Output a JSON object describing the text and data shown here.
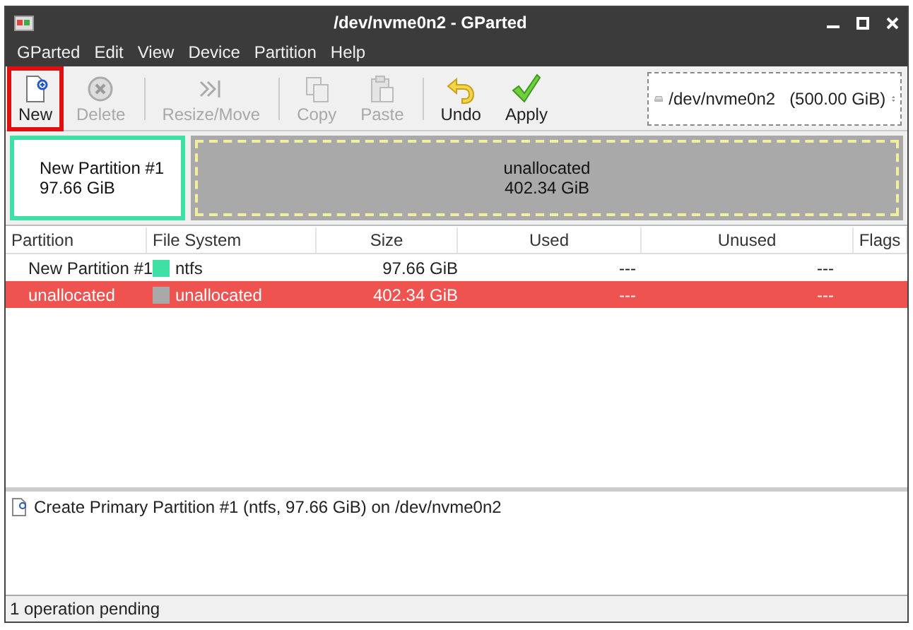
{
  "window": {
    "title": "/dev/nvme0n2 - GParted"
  },
  "menu": [
    "GParted",
    "Edit",
    "View",
    "Device",
    "Partition",
    "Help"
  ],
  "toolbar": [
    {
      "label": "New",
      "kind": "new",
      "disabled": false,
      "highlighted": true
    },
    {
      "label": "Delete",
      "kind": "delete",
      "disabled": true,
      "highlighted": false
    },
    {
      "label": "Resize/Move",
      "kind": "resize",
      "disabled": true,
      "highlighted": false
    },
    {
      "label": "Copy",
      "kind": "copy",
      "disabled": true,
      "highlighted": false
    },
    {
      "label": "Paste",
      "kind": "paste",
      "disabled": true,
      "highlighted": false
    },
    {
      "label": "Undo",
      "kind": "undo",
      "disabled": false,
      "highlighted": false
    },
    {
      "label": "Apply",
      "kind": "apply",
      "disabled": false,
      "highlighted": false
    }
  ],
  "device": {
    "name": "/dev/nvme0n2",
    "size": "(500.00 GiB)"
  },
  "disk_map": [
    {
      "name": "New Partition #1",
      "size": "97.66 GiB",
      "color": "#3ee0a6",
      "selected": false
    },
    {
      "name": "unallocated",
      "size": "402.34 GiB",
      "color": "#a9a9a9",
      "selected": true
    }
  ],
  "table": {
    "columns": [
      "Partition",
      "File System",
      "Size",
      "Used",
      "Unused",
      "Flags"
    ],
    "rows": [
      {
        "partition": "New Partition #1",
        "file_system": "ntfs",
        "color": "#3ee0a6",
        "size": "97.66 GiB",
        "used": "---",
        "unused": "---",
        "selected": false
      },
      {
        "partition": "unallocated",
        "file_system": "unallocated",
        "color": "#a9a9a9",
        "size": "402.34 GiB",
        "used": "---",
        "unused": "---",
        "selected": true
      }
    ]
  },
  "operations": [
    "Create Primary Partition #1 (ntfs, 97.66 GiB) on /dev/nvme0n2"
  ],
  "status_bar": "1 operation pending"
}
